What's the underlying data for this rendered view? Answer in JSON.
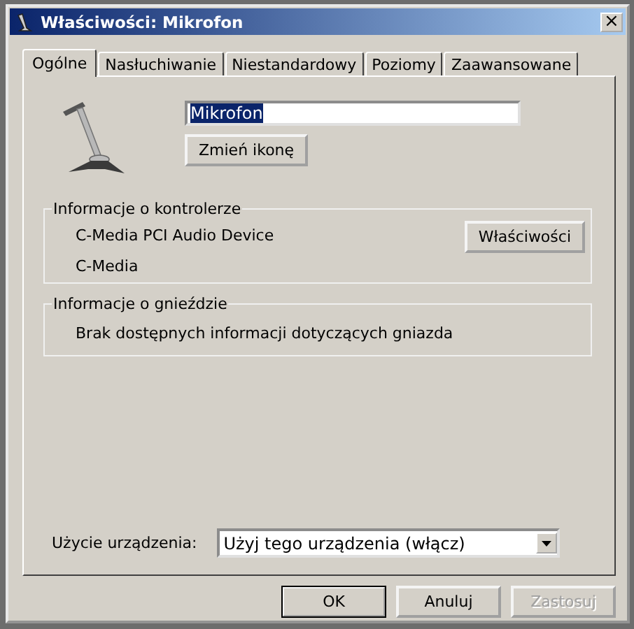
{
  "window": {
    "title": "Właściwości: Mikrofon",
    "close": "×"
  },
  "tabs": [
    {
      "label": "Ogólne",
      "selected": true
    },
    {
      "label": "Nasłuchiwanie",
      "selected": false
    },
    {
      "label": "Niestandardowy",
      "selected": false
    },
    {
      "label": "Poziomy",
      "selected": false
    },
    {
      "label": "Zaawansowane",
      "selected": false
    }
  ],
  "device": {
    "name": "Mikrofon",
    "name_highlighted": true,
    "change_icon_button": "Zmień ikonę"
  },
  "controller_info": {
    "title": "Informacje o kontrolerze",
    "lines": [
      "C-Media PCI Audio Device",
      "C-Media"
    ],
    "button": "Właściwości"
  },
  "jack_info": {
    "title": "Informacje o gnieździe",
    "text": "Brak dostępnych informacji dotyczących gniazda"
  },
  "device_usage": {
    "label": "Użycie urządzenia:",
    "value": "Użyj tego urządzenia (włącz)"
  },
  "buttons": [
    {
      "label": "OK",
      "default": true,
      "disabled": false
    },
    {
      "label": "Anuluj",
      "default": false,
      "disabled": false
    },
    {
      "label": "Zastosuj",
      "default": false,
      "disabled": true
    }
  ]
}
